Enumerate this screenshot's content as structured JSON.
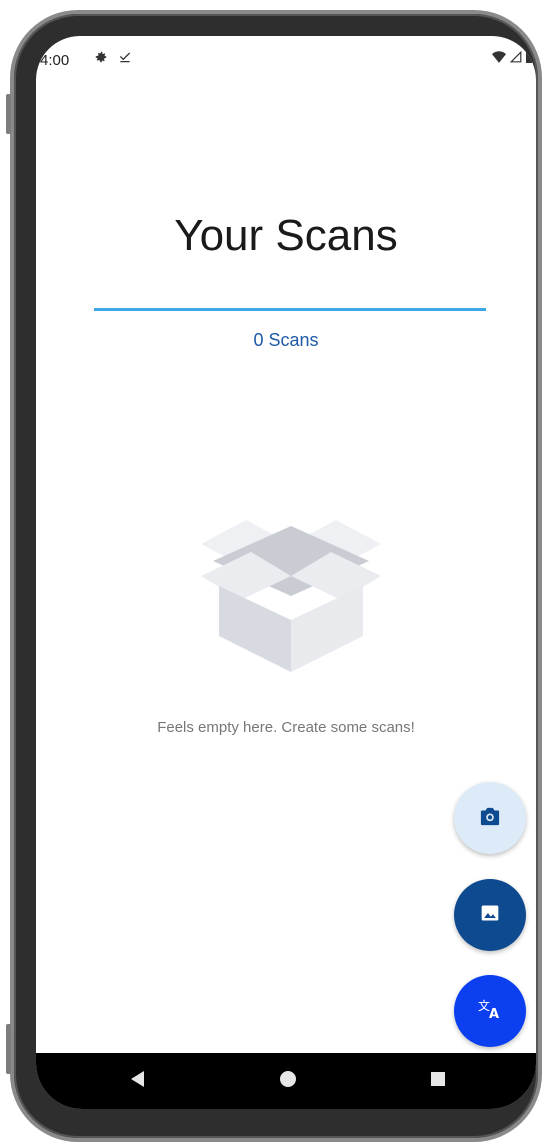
{
  "status_bar": {
    "time": "4:00",
    "left_icons": [
      "gear-icon",
      "download-done-icon"
    ],
    "right_icons": [
      "wifi-icon",
      "signal-icon",
      "battery-icon"
    ]
  },
  "header": {
    "title": "Your Scans",
    "scan_count": "0 Scans",
    "accent_color": "#3fa7e8"
  },
  "empty_state": {
    "illustration": "open-box-icon",
    "message": "Feels empty here. Create some scans!"
  },
  "fabs": [
    {
      "name": "camera",
      "icon": "camera-icon",
      "color": "#dcebf7"
    },
    {
      "name": "gallery",
      "icon": "image-icon",
      "color": "#0e4a8f"
    },
    {
      "name": "translate",
      "icon": "translate-icon",
      "color": "#0b3ff0"
    }
  ],
  "nav_bar": {
    "buttons": [
      "back-icon",
      "home-icon",
      "recents-icon"
    ]
  }
}
